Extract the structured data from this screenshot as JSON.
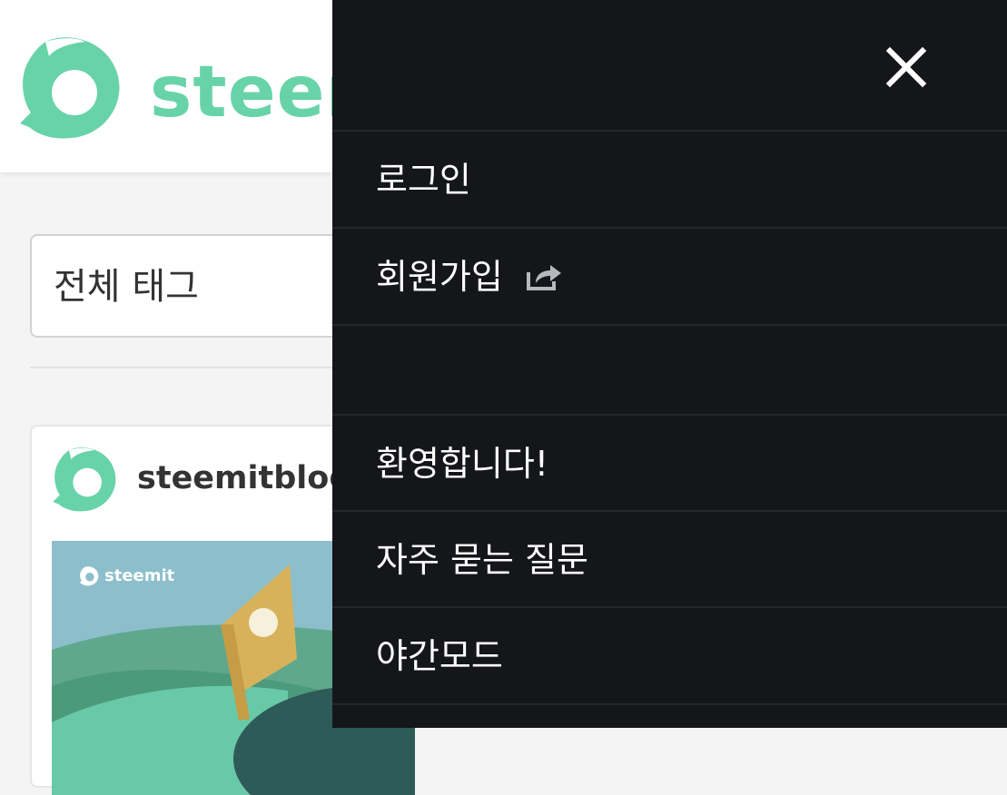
{
  "header": {
    "logo_text": "steem",
    "logo_icon": "steemit-logo-icon"
  },
  "filters": {
    "tag_select_value": "전체 태그"
  },
  "feed": {
    "posts": [
      {
        "author": "steemitblog",
        "image_brand": "steemit"
      }
    ]
  },
  "side_menu": {
    "close_icon": "close-icon",
    "items": [
      {
        "label": "로그인"
      },
      {
        "label": "회원가입",
        "icon": "external-link-icon"
      },
      {
        "label": "환영합니다!"
      },
      {
        "label": "자주 묻는 질문"
      },
      {
        "label": "야간모드"
      }
    ]
  },
  "colors": {
    "brand": "#68d3a9",
    "menu_bg": "#14161a",
    "menu_rule": "#24272c",
    "menu_text": "#ffffff"
  }
}
